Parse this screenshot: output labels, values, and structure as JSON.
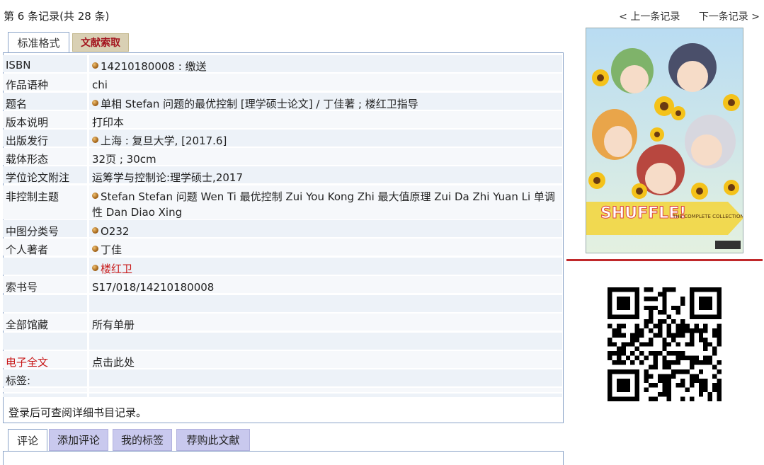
{
  "header": {
    "record_count": "第 6 条记录(共 28 条)",
    "prev_label": "< 上一条记录",
    "next_label": "下一条记录 >"
  },
  "tabs_top": {
    "standard": "标准格式",
    "citation": "文献索取"
  },
  "record": [
    {
      "label": "ISBN",
      "value": "14210180008 : 缴送",
      "bullet": true
    },
    {
      "label": "作品语种",
      "value": "chi",
      "bullet": false
    },
    {
      "label": "题名",
      "value": "单相 Stefan 问题的最优控制 [理学硕士论文]  / 丁佳著 ; 楼红卫指导",
      "bullet": true
    },
    {
      "label": "版本说明",
      "value": "打印本",
      "bullet": false
    },
    {
      "label": "出版发行",
      "value": "上海 : 复旦大学, [2017.6]",
      "bullet": true
    },
    {
      "label": "载体形态",
      "value": "32页 ; 30cm",
      "bullet": false
    },
    {
      "label": "学位论文附注",
      "value": "运筹学与控制论:理学硕士,2017",
      "bullet": false
    },
    {
      "label": "非控制主题",
      "value": "Stefan Stefan 问题 Wen Ti 最优控制 Zui You Kong Zhi 最大值原理 Zui Da Zhi Yuan Li 单调性 Dan Diao Xing",
      "bullet": true
    },
    {
      "label": "中图分类号",
      "value": "O232",
      "bullet": true
    },
    {
      "label": "个人著者",
      "value": "丁佳",
      "bullet": true
    },
    {
      "label": "",
      "value": "楼红卫",
      "bullet": true
    },
    {
      "label": "索书号",
      "value": "S17/018/14210180008",
      "bullet": false
    },
    {
      "label": "",
      "value": "",
      "bullet": false
    },
    {
      "label": "全部馆藏",
      "value": "所有单册",
      "bullet": false
    },
    {
      "label": "",
      "value": "",
      "bullet": false
    },
    {
      "label": "电子全文",
      "value": "点击此处",
      "bullet": false
    },
    {
      "label": "标签:",
      "value": "",
      "bullet": false
    }
  ],
  "login_note": "登录后可查阅详细书目记录。",
  "tabs_bottom": [
    "评论",
    "添加评论",
    "我的标签",
    "荐购此文献"
  ],
  "colors": {
    "accent_red": "#c81818",
    "border_blue": "#8aa3c8",
    "row_bg": "#edf2f8",
    "tab_purple": "#c9c9ee"
  }
}
